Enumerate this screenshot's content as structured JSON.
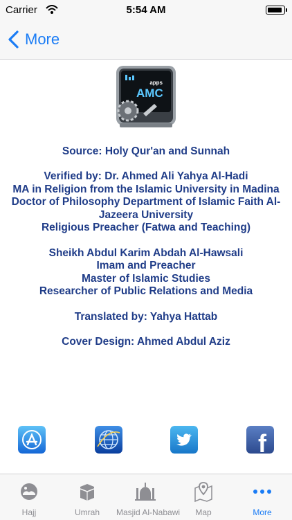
{
  "status_bar": {
    "carrier": "Carrier",
    "time": "5:54 AM"
  },
  "nav": {
    "back_label": "More"
  },
  "logo": {
    "small": "apps",
    "big": "AMC"
  },
  "credits": [
    [
      "Source: Holy Qur'an and Sunnah"
    ],
    [
      "Verified by: Dr. Ahmed Ali Yahya Al-Hadi",
      "MA in Religion from the Islamic University in Madina",
      "Doctor of Philosophy Department of Islamic Faith Al-Jazeera University",
      "Religious Preacher (Fatwa and Teaching)"
    ],
    [
      "Sheikh Abdul Karim Abdah Al-Hawsali",
      "Imam and Preacher",
      "Master of Islamic Studies",
      "Researcher of Public Relations and Media"
    ],
    [
      "Translated by: Yahya Hattab"
    ],
    [
      "Cover Design: Ahmed Abdul Aziz"
    ]
  ],
  "social": [
    {
      "icon": "app-store-icon"
    },
    {
      "icon": "website-globe-icon"
    },
    {
      "icon": "twitter-icon"
    },
    {
      "icon": "facebook-icon",
      "glyph": "f"
    }
  ],
  "tabs": [
    {
      "label": "Hajj",
      "icon": "hajj-icon",
      "active": false
    },
    {
      "label": "Umrah",
      "icon": "kaaba-icon",
      "active": false
    },
    {
      "label": "Masjid Al-Nabawi",
      "icon": "mosque-icon",
      "active": false
    },
    {
      "label": "Map",
      "icon": "map-icon",
      "active": false
    },
    {
      "label": "More",
      "icon": "more-icon",
      "active": true
    }
  ],
  "colors": {
    "accent": "#1a7cf5",
    "text": "#1f3c88",
    "inactive": "#8e8e93"
  }
}
